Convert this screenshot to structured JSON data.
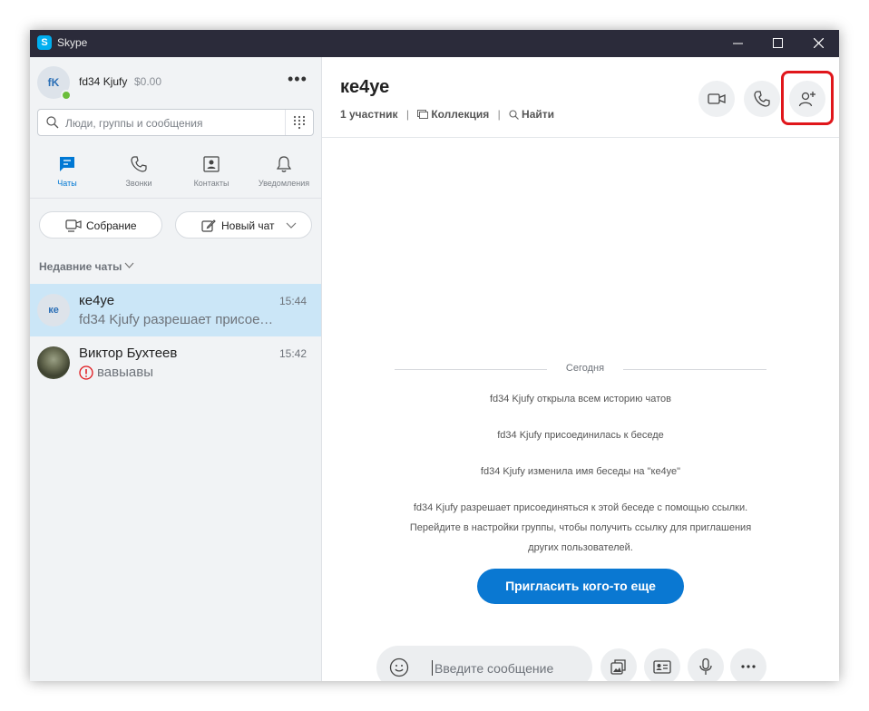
{
  "window": {
    "title": "Skype",
    "logo_letter": "S"
  },
  "profile": {
    "initials": "fK",
    "name": "fd34 Kjufy",
    "balance": "$0.00",
    "more": "•••"
  },
  "search": {
    "placeholder": "Люди, группы и сообщения"
  },
  "nav": [
    {
      "label": "Чаты",
      "icon": "chat-icon",
      "active": true
    },
    {
      "label": "Звонки",
      "icon": "phone-icon"
    },
    {
      "label": "Контакты",
      "icon": "contacts-icon"
    },
    {
      "label": "Уведомления",
      "icon": "bell-icon"
    }
  ],
  "actions": {
    "meeting": "Собрание",
    "new_chat": "Новый чат"
  },
  "recent_header": "Недавние чаты",
  "chats": [
    {
      "initials": "ке",
      "name": "ке4уе",
      "time": "15:44",
      "preview": "fd34 Kjufy разрешает присоеди...",
      "active": true
    },
    {
      "name": "Виктор Бухтеев",
      "time": "15:42",
      "preview": "вавыавы",
      "error": true
    }
  ],
  "conversation": {
    "title": "ке4уе",
    "participants": "1 участник",
    "collection": "Коллекция",
    "find": "Найти"
  },
  "timeline": {
    "date": "Сегодня",
    "messages": [
      "fd34 Kjufy открыла всем историю чатов",
      "fd34 Kjufy присоединилась к беседе",
      "fd34 Kjufy изменила имя беседы на \"ке4уе\""
    ],
    "link_info": [
      "fd34 Kjufy разрешает присоединяться к этой беседе с помощью ссылки.",
      "Перейдите в настройки группы, чтобы получить ссылку для приглашения",
      "других пользователей."
    ],
    "invite_button": "Пригласить кого-то еще"
  },
  "composer": {
    "placeholder": "Введите сообщение"
  },
  "colors": {
    "accent": "#0a78d2",
    "highlight": "#e0161b",
    "sidebar_bg": "#f1f3f5",
    "active_chat_bg": "#cbe6f7"
  }
}
